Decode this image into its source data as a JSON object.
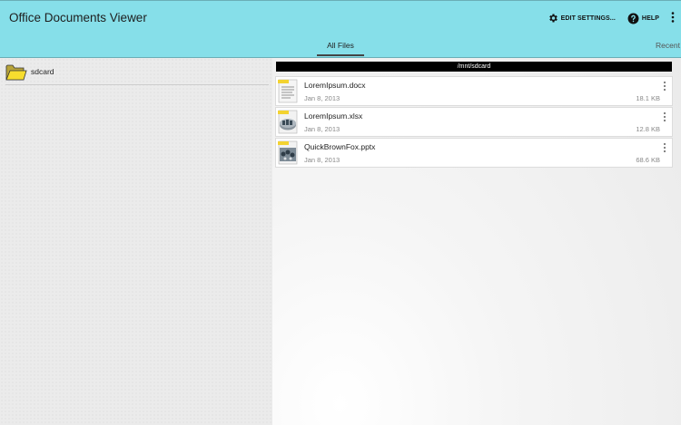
{
  "app": {
    "title": "Office Documents Viewer",
    "accent_color": "#86dfe9"
  },
  "actions": {
    "edit_settings_label": "EDIT SETTINGS...",
    "edit_settings_icon": "gear-icon",
    "help_label": "HELP",
    "help_icon": "help-circle-icon",
    "overflow_icon": "overflow-menu-icon"
  },
  "tabs": [
    {
      "label": "All Files",
      "selected": true
    },
    {
      "label": "Recent",
      "selected": false
    }
  ],
  "folders": [
    {
      "label": "sdcard",
      "icon": "folder-icon"
    }
  ],
  "path": "/mnt/sdcard",
  "files": [
    {
      "name": "LoremIpsum.docx",
      "date": "Jan 8, 2013",
      "size": "18.1 KB",
      "icon": "document-file-icon"
    },
    {
      "name": "LoremIpsum.xlsx",
      "date": "Jan 8, 2013",
      "size": "12.8 KB",
      "icon": "spreadsheet-file-icon"
    },
    {
      "name": "QuickBrownFox.pptx",
      "date": "Jan 8, 2013",
      "size": "68.6 KB",
      "icon": "presentation-file-icon"
    }
  ]
}
